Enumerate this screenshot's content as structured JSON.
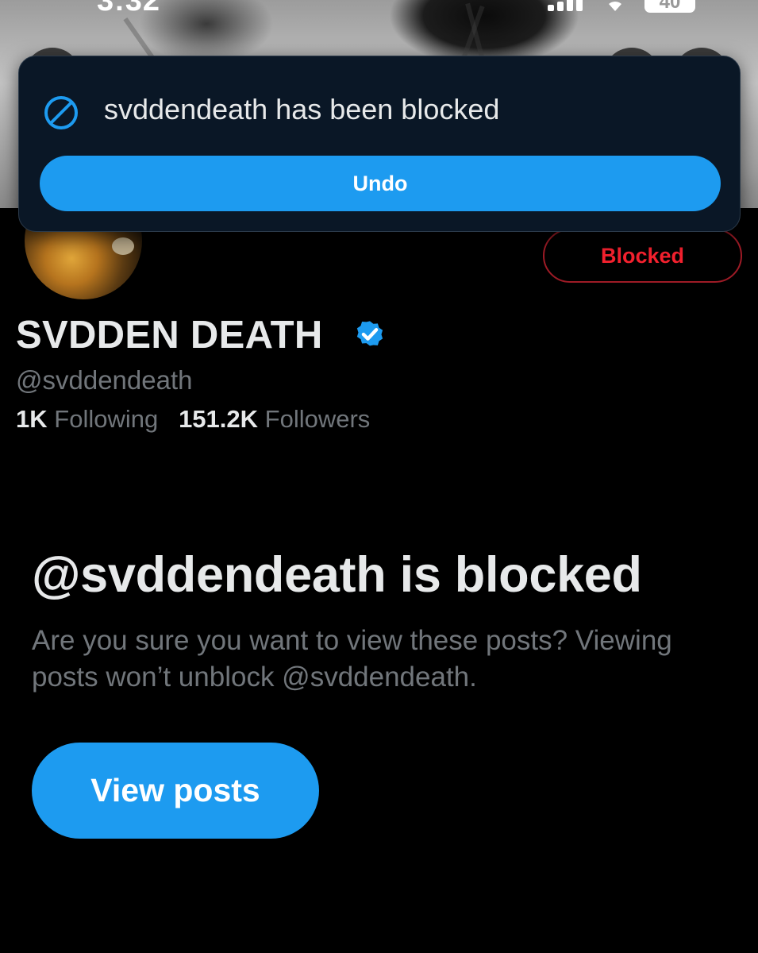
{
  "status_bar": {
    "time": "3:32",
    "battery": "40"
  },
  "toast": {
    "message": "svddendeath has been blocked",
    "undo_label": "Undo",
    "icon": "block-icon",
    "accent_color": "#1d9bf0"
  },
  "profile": {
    "display_name": "SVDDEN DEATH",
    "verified": true,
    "handle": "@svddendeath",
    "following_count": "1K",
    "following_label": "Following",
    "followers_count": "151.2K",
    "followers_label": "Followers",
    "blocked_button_label": "Blocked",
    "blocked_color": "#f4212e"
  },
  "blocked_notice": {
    "heading": "@svddendeath is blocked",
    "description": "Are you sure you want to view these posts? Viewing posts won’t unblock @svddendeath.",
    "view_posts_label": "View posts"
  }
}
